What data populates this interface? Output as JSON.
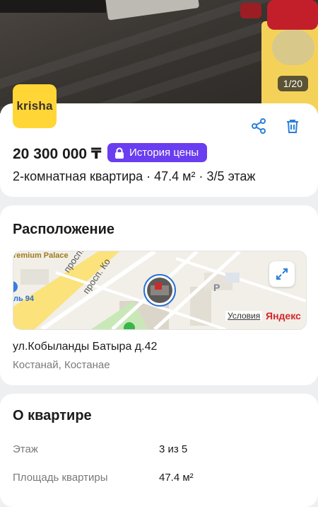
{
  "photo": {
    "counter": "1/20"
  },
  "brand": {
    "logo_text": "krisha"
  },
  "listing": {
    "price": "20 300 000 ₸",
    "price_history_label": "История цены",
    "description": "2-комнатная квартира · 47.4 м² · 3/5 этаж"
  },
  "location": {
    "title": "Расположение",
    "map": {
      "poi_premium": "remium Palace",
      "poi_94": "ль 94",
      "street_1": "просп. К",
      "street_2": "просп. Ко",
      "parking": "P",
      "terms": "Условия",
      "provider": "Яндекс"
    },
    "address": "ул.Кобыланды Батыра д.42",
    "city": "Костанай, Костанае"
  },
  "about": {
    "title": "О квартире",
    "rows": [
      {
        "label": "Этаж",
        "value": "3 из 5"
      },
      {
        "label": "Площадь квартиры",
        "value": "47.4 м²"
      }
    ]
  },
  "colors": {
    "accent": "#6a3df0",
    "logo_bg": "#ffd635",
    "icon_blue": "#2b7fd8"
  }
}
